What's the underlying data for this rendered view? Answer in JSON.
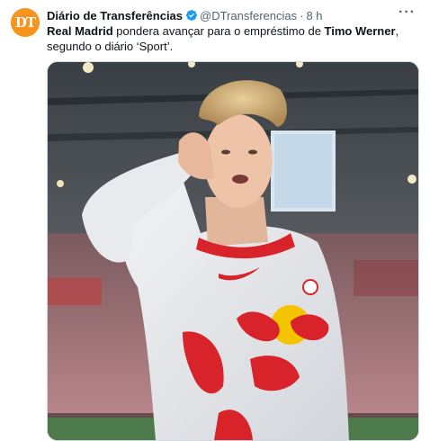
{
  "tweet": {
    "author_name": "Diário de Transferências",
    "handle": "@DTransferencias",
    "separator": "·",
    "time": "8 h",
    "more_label": "···",
    "avatar_initials": "DT",
    "text_parts": [
      {
        "text": "Real Madrid",
        "bold": true
      },
      {
        "text": " pondera avançar para o empréstimo de ",
        "bold": false
      },
      {
        "text": "Timo Werner",
        "bold": true
      },
      {
        "text": ",\nsegundo o diário ‘Sport’.",
        "bold": false
      }
    ],
    "media_icon": "photo-of-football-player-celebrating"
  },
  "colors": {
    "avatar_bg": "#f7941d",
    "verified_blue": "#1d9bf0",
    "jersey_red": "#d8232a",
    "jersey_yellow": "#f5c400"
  }
}
